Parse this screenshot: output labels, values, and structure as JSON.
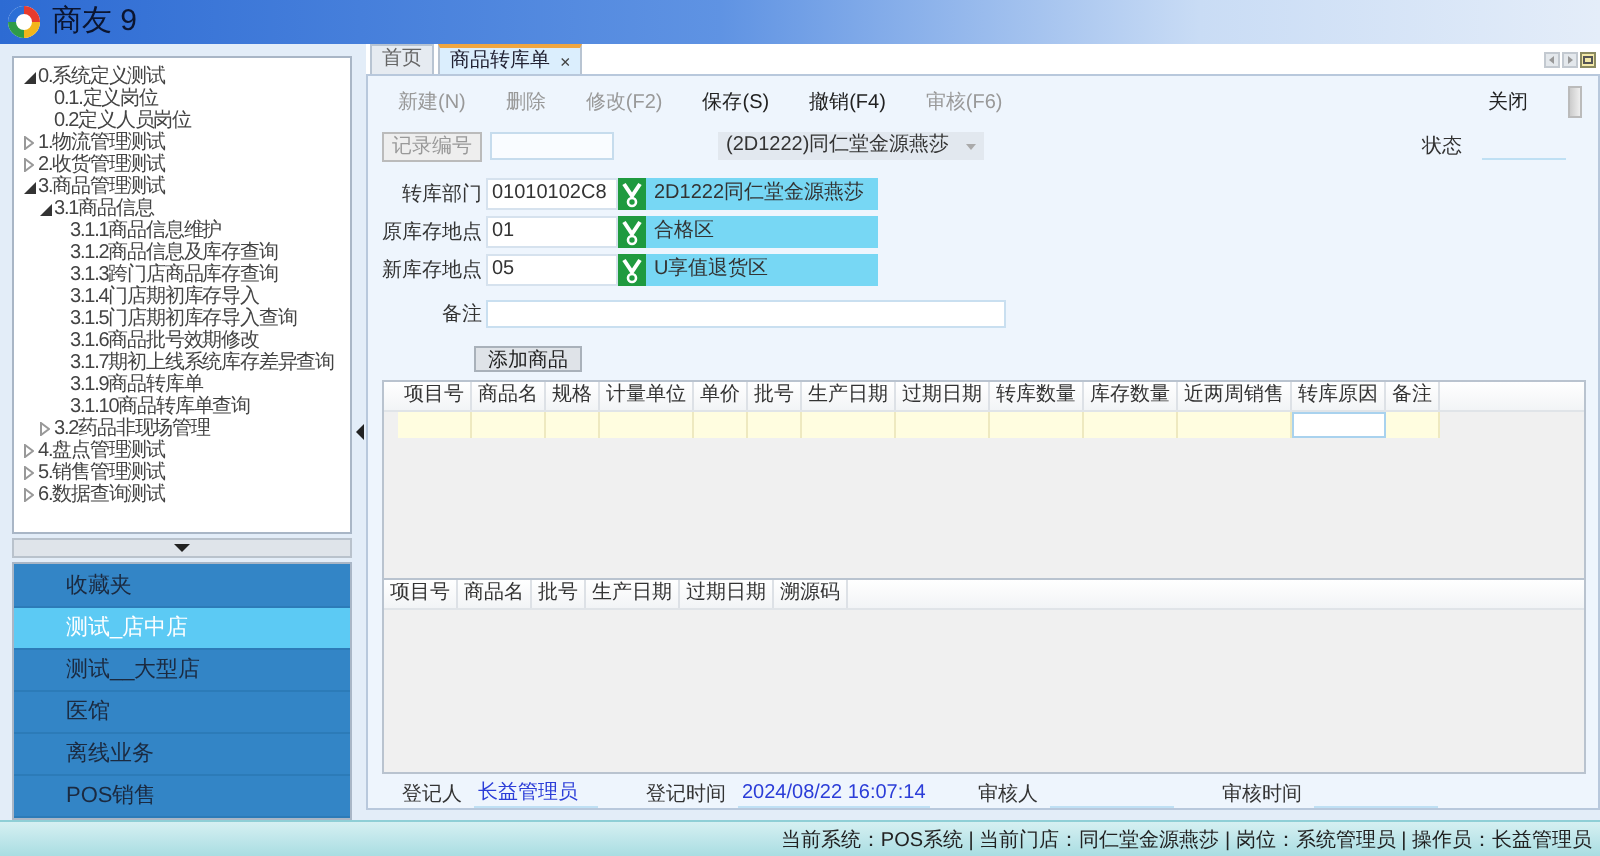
{
  "window": {
    "title": "商友 9"
  },
  "tree": [
    {
      "label": "0.系统定义测试",
      "expanded": true,
      "children": [
        {
          "label": "0.1.定义岗位"
        },
        {
          "label": "0.2定义人员岗位"
        }
      ]
    },
    {
      "label": "1.物流管理测试",
      "expanded": false
    },
    {
      "label": "2.收货管理测试",
      "expanded": false
    },
    {
      "label": "3.商品管理测试",
      "expanded": true,
      "children": [
        {
          "label": "3.1商品信息",
          "expanded": true,
          "children": [
            {
              "label": "3.1.1商品信息维护"
            },
            {
              "label": "3.1.2商品信息及库存查询"
            },
            {
              "label": "3.1.3跨门店商品库存查询"
            },
            {
              "label": "3.1.4门店期初库存导入"
            },
            {
              "label": "3.1.5门店期初库存导入查询"
            },
            {
              "label": "3.1.6商品批号效期修改"
            },
            {
              "label": "3.1.7期初上线系统库存差异查询"
            },
            {
              "label": "3.1.9商品转库单"
            },
            {
              "label": "3.1.10商品转库单查询"
            }
          ]
        },
        {
          "label": "3.2药品非现场管理",
          "expanded": false
        }
      ]
    },
    {
      "label": "4.盘点管理测试",
      "expanded": false
    },
    {
      "label": "5.销售管理测试",
      "expanded": false
    },
    {
      "label": "6.数据查询测试",
      "expanded": false
    }
  ],
  "nav_menu": [
    {
      "label": "收藏夹",
      "selected": false
    },
    {
      "label": "测试_店中店",
      "selected": true
    },
    {
      "label": "测试__大型店",
      "selected": false
    },
    {
      "label": "医馆",
      "selected": false
    },
    {
      "label": "离线业务",
      "selected": false
    },
    {
      "label": "POS销售",
      "selected": false
    }
  ],
  "tabs": [
    {
      "label": "首页",
      "selected": false
    },
    {
      "label": "商品转库单",
      "selected": true,
      "close": "×"
    }
  ],
  "toolbar": [
    {
      "label": "新建(N)",
      "disabled": true
    },
    {
      "label": "删除",
      "disabled": true
    },
    {
      "label": "修改(F2)",
      "disabled": true
    },
    {
      "label": "保存(S)",
      "disabled": false
    },
    {
      "label": "撤销(F4)",
      "disabled": false
    },
    {
      "label": "审核(F6)",
      "disabled": true
    }
  ],
  "close_button": "关闭",
  "record": {
    "label": "记录编号",
    "store_dropdown": "(2D1222)同仁堂金源燕莎",
    "status_label": "状态"
  },
  "fields": [
    {
      "label": "转库部门",
      "code": "01010102C8",
      "name": "2D1222同仁堂金源燕莎"
    },
    {
      "label": "原库存地点",
      "code": "01",
      "name": "合格区"
    },
    {
      "label": "新库存地点",
      "code": "05",
      "name": "U享值退货区"
    }
  ],
  "remark": {
    "label": "备注"
  },
  "add_button": "添加商品",
  "grid": {
    "columns": [
      {
        "label": "项目号",
        "editable": false
      },
      {
        "label": "商品名",
        "editable": false
      },
      {
        "label": "规格",
        "editable": false
      },
      {
        "label": "计量单位",
        "editable": false
      },
      {
        "label": "单价",
        "editable": false
      },
      {
        "label": "批号",
        "editable": false
      },
      {
        "label": "生产日期",
        "editable": false
      },
      {
        "label": "过期日期",
        "editable": false
      },
      {
        "label": "转库数量",
        "editable": false
      },
      {
        "label": "库存数量",
        "editable": false
      },
      {
        "label": "近两周销售",
        "editable": false
      },
      {
        "label": "转库原因",
        "editable": true
      },
      {
        "label": "备注",
        "editable": false
      }
    ]
  },
  "trace_grid": {
    "columns": [
      "项目号",
      "商品名",
      "批号",
      "生产日期",
      "过期日期",
      "溯源码"
    ]
  },
  "footer": [
    {
      "label": "登记人",
      "value": "长益管理员"
    },
    {
      "label": "登记时间",
      "value": "2024/08/22 16:07:14"
    },
    {
      "label": "审核人"
    },
    {
      "label": "审核时间"
    }
  ],
  "status_bar": "当前系统：POS系统 | 当前门店：同仁堂金源燕莎 | 岗位：系统管理员 | 操作员：长益管理员"
}
